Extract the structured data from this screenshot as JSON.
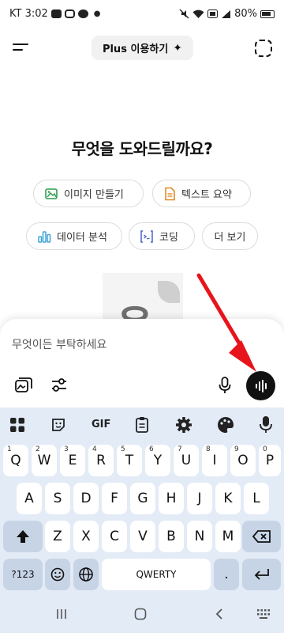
{
  "status_bar": {
    "carrier_time": "KT 3:02",
    "battery": "80%"
  },
  "header": {
    "plus_label": "Plus 이용하기",
    "plus_sparkle": "✦"
  },
  "headline": "무엇을 도와드릴까요?",
  "chips": [
    {
      "label": "이미지 만들기",
      "icon": "image-icon"
    },
    {
      "label": "텍스트 요약",
      "icon": "document-icon"
    },
    {
      "label": "데이터 분석",
      "icon": "bar-chart-icon"
    },
    {
      "label": "코딩",
      "icon": "terminal-icon"
    },
    {
      "label": "더 보기",
      "icon": ""
    }
  ],
  "watermark": {
    "text": "윤"
  },
  "composer": {
    "placeholder": "무엇이든 부탁하세요"
  },
  "keyboard": {
    "toolbar": {
      "gif": "GIF"
    },
    "row1": [
      {
        "k": "Q",
        "h": "1"
      },
      {
        "k": "W",
        "h": "2"
      },
      {
        "k": "E",
        "h": "3"
      },
      {
        "k": "R",
        "h": "4"
      },
      {
        "k": "T",
        "h": "5"
      },
      {
        "k": "Y",
        "h": "6"
      },
      {
        "k": "U",
        "h": "7"
      },
      {
        "k": "I",
        "h": "8"
      },
      {
        "k": "O",
        "h": "9"
      },
      {
        "k": "P",
        "h": "0"
      }
    ],
    "row2": [
      "A",
      "S",
      "D",
      "F",
      "G",
      "H",
      "J",
      "K",
      "L"
    ],
    "row3": [
      "Z",
      "X",
      "C",
      "V",
      "B",
      "N",
      "M"
    ],
    "symbols": "?123",
    "space": "QWERTY",
    "period": "."
  },
  "colors": {
    "accent_arrow": "#e8141b",
    "keyboard_bg": "#e3ebf6",
    "voice_button": "#111111"
  }
}
